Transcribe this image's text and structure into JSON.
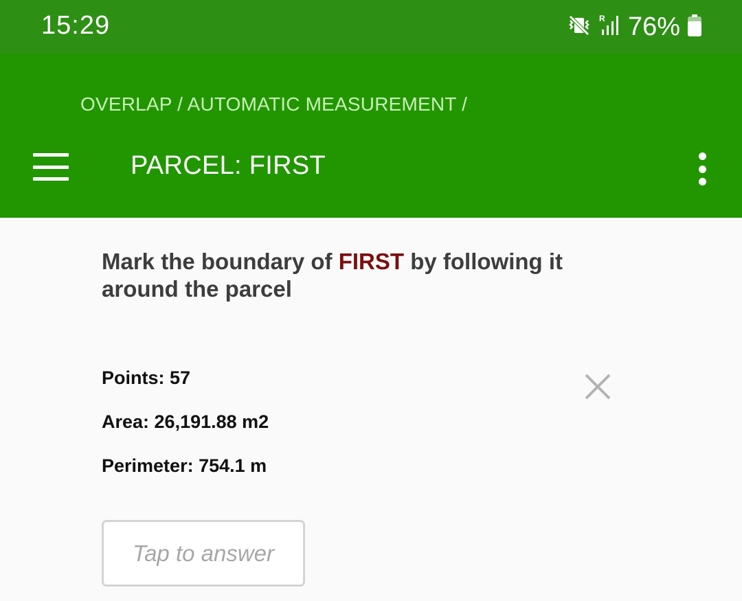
{
  "status_bar": {
    "time": "15:29",
    "battery": "76%",
    "icons": [
      "vibrate-off-icon",
      "roaming-signal-icon",
      "battery-icon"
    ]
  },
  "app_bar": {
    "breadcrumb": "OVERLAP / AUTOMATIC MEASUREMENT /",
    "title": "PARCEL: FIRST",
    "icons": [
      "menu-icon",
      "more-vert-icon"
    ]
  },
  "question": {
    "text_before": "Mark the boundary of ",
    "highlight": "FIRST",
    "text_after": " by following it around the parcel",
    "highlight_color": "#7b0f0f"
  },
  "measurement": {
    "points": "Points: 57",
    "area": "Area: 26,191.88 m2",
    "perimeter": "Perimeter: 754.1 m",
    "clear_icon": "close-icon"
  },
  "answer": {
    "placeholder": "Tap to answer"
  },
  "colors": {
    "status_bar": "#2e8f15",
    "app_bar": "#229601",
    "background": "#fafafa"
  }
}
